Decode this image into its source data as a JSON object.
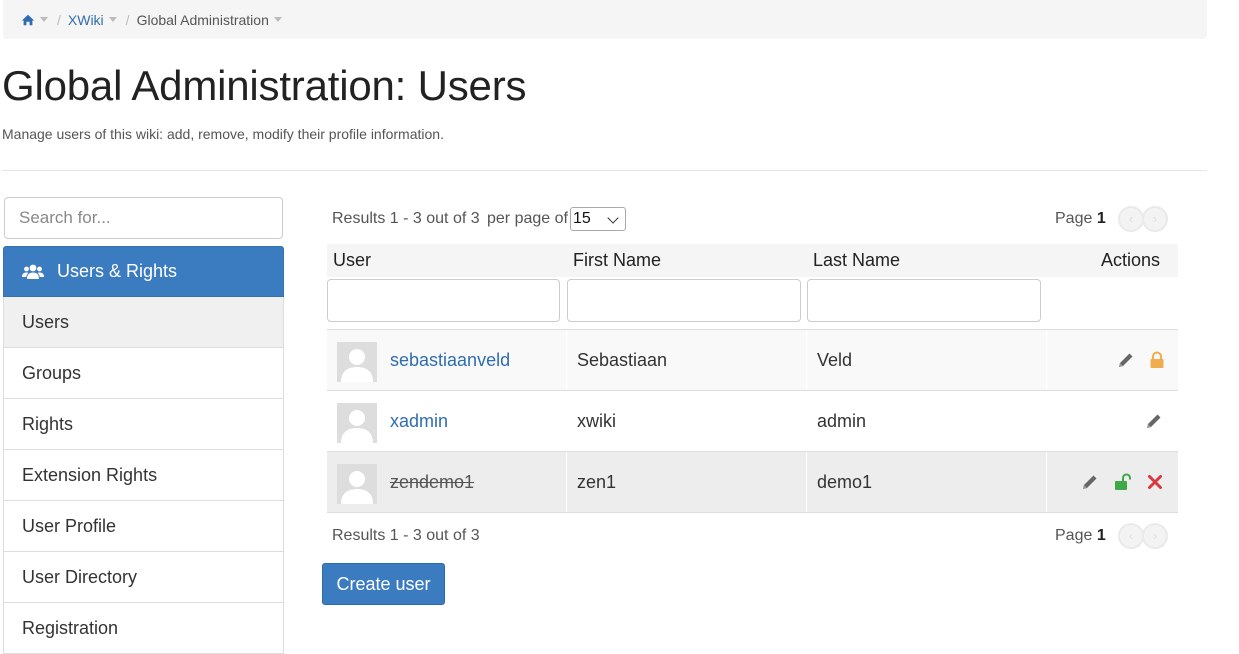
{
  "breadcrumb": {
    "home_icon": "home-icon",
    "items": [
      {
        "label": "XWiki"
      },
      {
        "label": "Global Administration"
      }
    ]
  },
  "page": {
    "title": "Global Administration: Users",
    "description": "Manage users of this wiki: add, remove, modify their profile information."
  },
  "sidebar": {
    "search_placeholder": "Search for...",
    "header": {
      "label": "Users & Rights",
      "icon": "users-icon"
    },
    "items": [
      {
        "label": "Users",
        "active": true
      },
      {
        "label": "Groups"
      },
      {
        "label": "Rights"
      },
      {
        "label": "Extension Rights"
      },
      {
        "label": "User Profile"
      },
      {
        "label": "User Directory"
      },
      {
        "label": "Registration"
      }
    ]
  },
  "table": {
    "results_summary": "Results 1 - 3 out of 3",
    "per_page_label": "per page of",
    "per_page_value": "15",
    "page_label": "Page",
    "page_number": "1",
    "columns": [
      "User",
      "First Name",
      "Last Name",
      "Actions"
    ],
    "rows": [
      {
        "user": "sebastiaanveld",
        "first_name": "Sebastiaan",
        "last_name": "Veld",
        "disabled": false,
        "actions": [
          "edit-icon",
          "lock-icon"
        ]
      },
      {
        "user": "xadmin",
        "first_name": "xwiki",
        "last_name": "admin",
        "disabled": false,
        "actions": [
          "edit-icon"
        ]
      },
      {
        "user": "zendemo1",
        "first_name": "zen1",
        "last_name": "demo1",
        "disabled": true,
        "actions": [
          "edit-icon",
          "unlock-icon",
          "delete-icon"
        ]
      }
    ]
  },
  "actions": {
    "create_user_label": "Create user"
  },
  "colors": {
    "primary": "#3b7cc0",
    "link": "#2f6db0",
    "lock": "#f0ad4e",
    "unlock": "#3fa84a",
    "delete": "#d9363e"
  }
}
